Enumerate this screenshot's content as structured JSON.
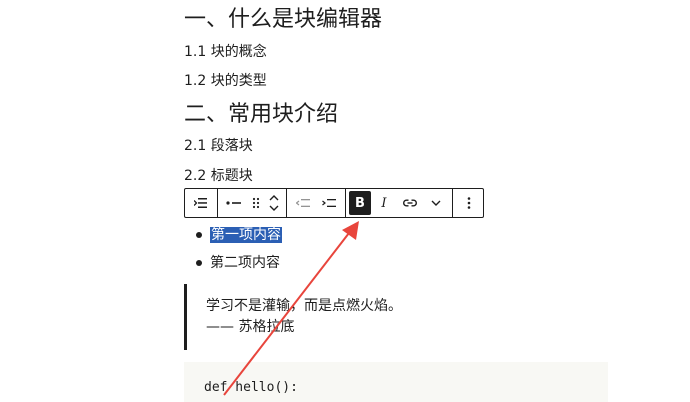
{
  "headings": {
    "h1": "一、什么是块编辑器",
    "h1_1": "1.1 块的概念",
    "h1_2": "1.2 块的类型",
    "h2": "二、常用块介绍",
    "h2_1": "2.1 段落块",
    "h2_2": "2.2 标题块"
  },
  "list": {
    "items": [
      "第一项内容",
      "第二项内容"
    ],
    "selected_index": 0
  },
  "quote": {
    "text": "学习不是灌输，而是点燃火焰。",
    "citation": "—— 苏格拉底"
  },
  "code": {
    "line1": "def hello():"
  },
  "toolbar": {
    "bold_label": "B",
    "italic_label": "I",
    "icons": [
      "list-transform-icon",
      "list-style-icon",
      "drag-handle-icon",
      "move-up-down-icon",
      "outdent-icon",
      "indent-icon",
      "bold-icon",
      "italic-icon",
      "link-icon",
      "more-rich-text-icon",
      "options-icon"
    ]
  },
  "colors": {
    "selection": "#2b5fb4",
    "arrow": "#e8453c",
    "text": "#1e1e1e",
    "code_bg": "#f8f8f4"
  }
}
